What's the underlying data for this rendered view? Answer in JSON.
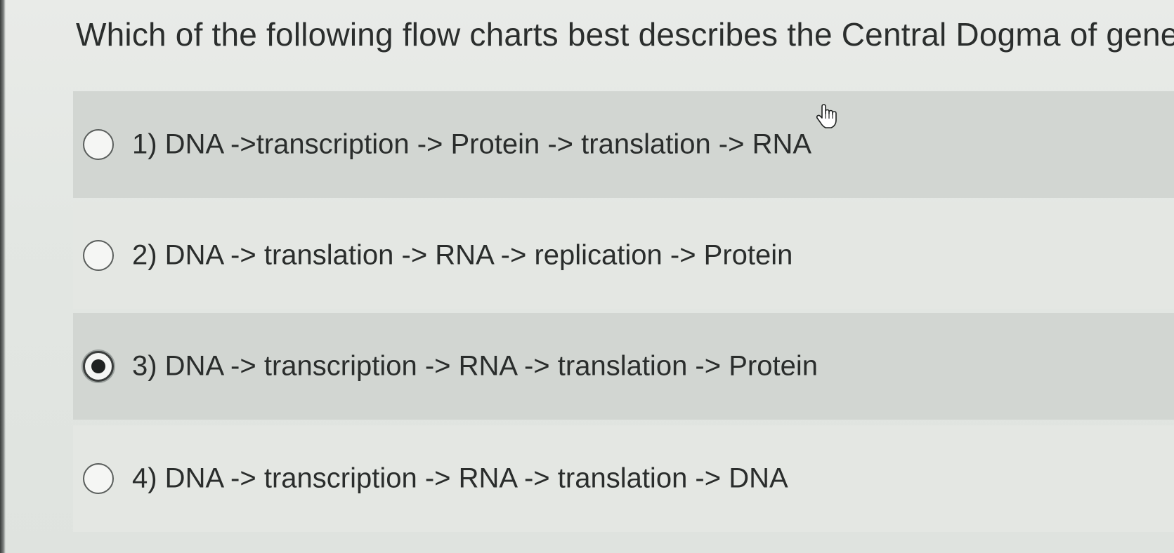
{
  "question": {
    "text": "Which of the following flow charts best describes the Central Dogma of gene"
  },
  "options": [
    {
      "number": "1)",
      "text": "1) DNA ->transcription -> Protein -> translation -> RNA",
      "selected": false
    },
    {
      "number": "2)",
      "text": "2) DNA -> translation -> RNA  ->  replication  -> Protein",
      "selected": false
    },
    {
      "number": "3)",
      "text": "3) DNA -> transcription -> RNA -> translation -> Protein",
      "selected": true
    },
    {
      "number": "4)",
      "text": "4) DNA  -> transcription -> RNA -> translation -> DNA",
      "selected": false
    }
  ],
  "colors": {
    "row_shaded": "#d2d6d2",
    "row_light": "#e4e7e3",
    "text": "#2a2d2c"
  },
  "icons": {
    "cursor": "hand-pointer-icon"
  }
}
